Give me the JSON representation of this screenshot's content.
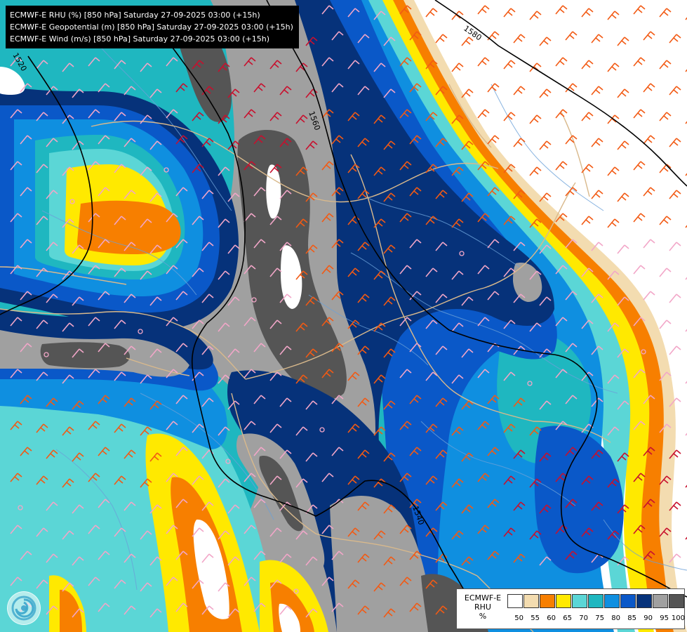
{
  "title_lines": [
    "ECMWF-E RHU (%) [850 hPa] Saturday 27-09-2025 03:00 (+15h)",
    "ECMWF-E Geopotential (m) [850 hPa] Saturday 27-09-2025 03:00 (+15h)",
    "ECMWF-E Wind (m/s) [850 hPa] Saturday 27-09-2025 03:00 (+15h)"
  ],
  "legend": {
    "caption_lines": [
      "ECMWF-E",
      "RHU",
      "%"
    ],
    "swatch_colors": [
      "#ffffff",
      "#f3dcb0",
      "#f77f00",
      "#ffe900",
      "#5bd6d6",
      "#1fb7c0",
      "#0f8fe0",
      "#0a58c8",
      "#06327a",
      "#a0a0a0",
      "#555555"
    ],
    "tick_labels": [
      "50",
      "55",
      "60",
      "65",
      "70",
      "75",
      "80",
      "85",
      "90",
      "95",
      "100"
    ]
  },
  "contour_labels": [
    "1520",
    "1560",
    "1580",
    "1540"
  ],
  "palette": {
    "white": "#ffffff",
    "cream": "#f3dcb0",
    "orange": "#f77f00",
    "yellow": "#ffe900",
    "cyan": "#5bd6d6",
    "teal": "#1fb7c0",
    "blue": "#0f8fe0",
    "mid_blue": "#0a58c8",
    "navy": "#06327a",
    "grey": "#a0a0a0",
    "dark_grey": "#555555",
    "border": "#d9b98c",
    "river": "#6aa0d8",
    "barb_red": "#c8102e",
    "barb_orange": "#f25a14",
    "barb_pink": "#f2a6c8"
  }
}
